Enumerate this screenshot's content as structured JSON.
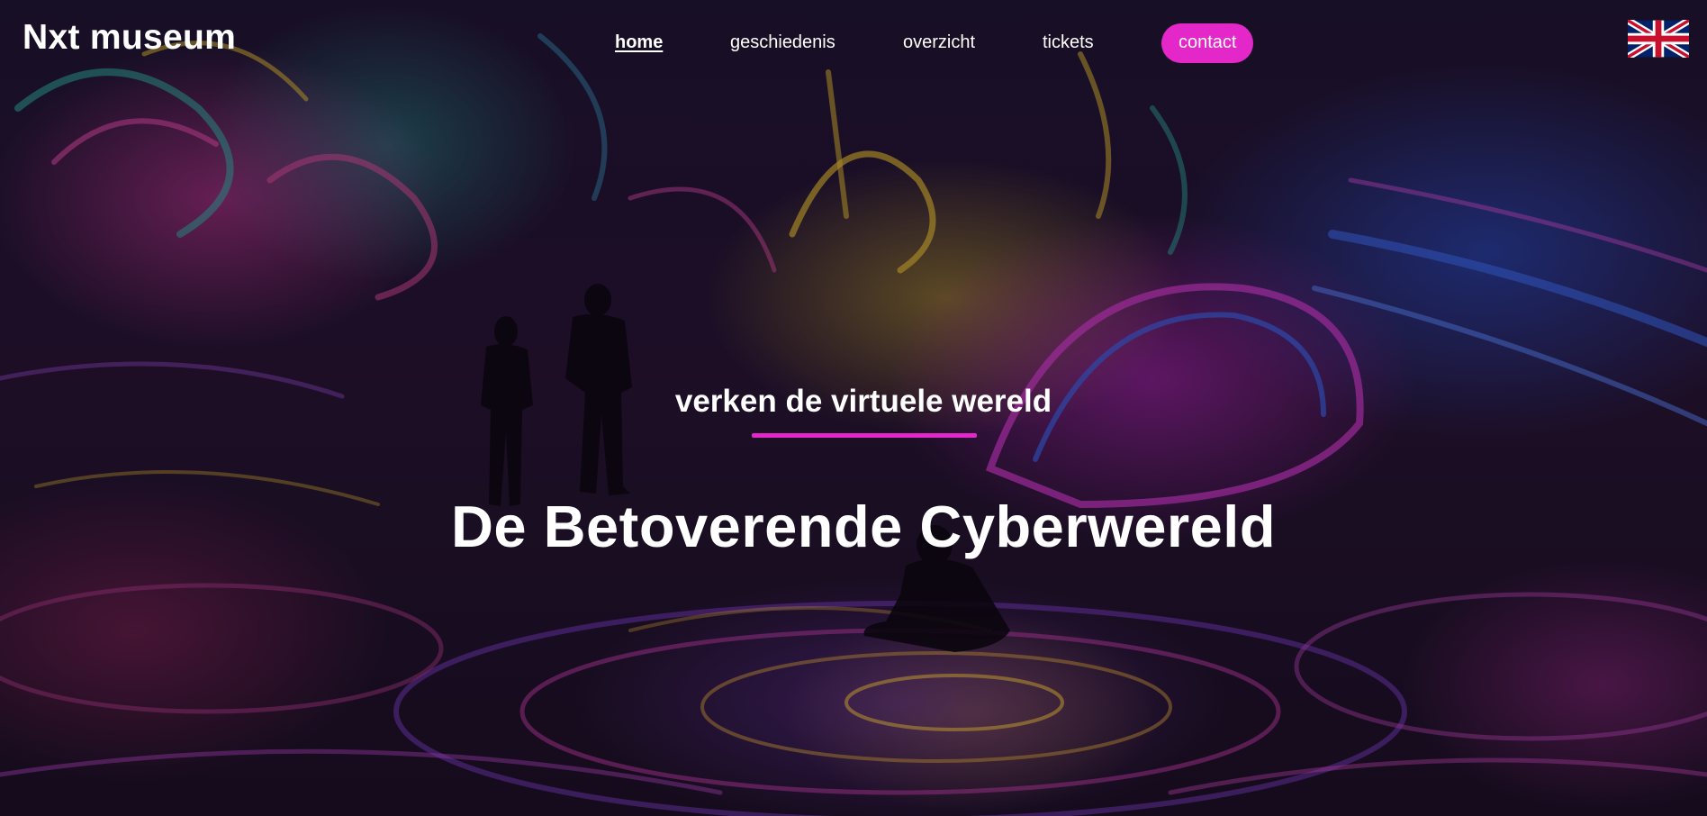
{
  "site": {
    "logo": "Nxt museum"
  },
  "nav": {
    "items": [
      {
        "label": "home",
        "active": true
      },
      {
        "label": "geschiedenis",
        "active": false
      },
      {
        "label": "overzicht",
        "active": false
      },
      {
        "label": "tickets",
        "active": false
      },
      {
        "label": "contact",
        "active": false,
        "highlight": true
      }
    ],
    "language_icon": "uk-flag-icon"
  },
  "hero": {
    "subtitle": "verken de virtuele wereld",
    "title": "De Betoverende Cyberwereld",
    "background": "immersive-digital-art-room-photo"
  },
  "colors": {
    "accent": "#e327c9",
    "text": "#ffffff"
  }
}
